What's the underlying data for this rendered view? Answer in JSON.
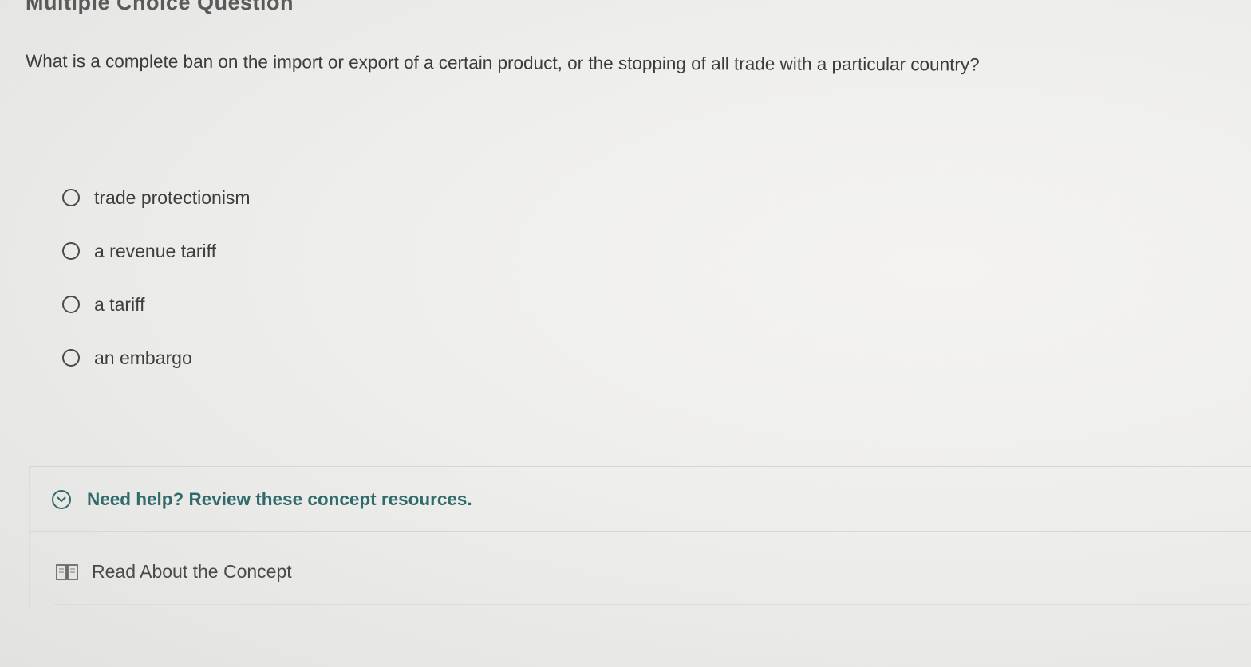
{
  "page": {
    "title": "Multiple Choice Question"
  },
  "question": {
    "text": "What is a complete ban on the import or export of a certain product, or the stopping of all trade with a particular country?"
  },
  "choices": [
    {
      "label": "trade protectionism",
      "selected": false
    },
    {
      "label": "a revenue tariff",
      "selected": false
    },
    {
      "label": "a tariff",
      "selected": false
    },
    {
      "label": "an embargo",
      "selected": false
    }
  ],
  "help": {
    "title": "Need help? Review these concept resources.",
    "expanded": true,
    "resources": [
      {
        "label": "Read About the Concept",
        "icon": "book-icon"
      }
    ]
  },
  "colors": {
    "accent": "#2f6b6a",
    "text": "#3c3c3c",
    "background": "#eeeeec"
  }
}
